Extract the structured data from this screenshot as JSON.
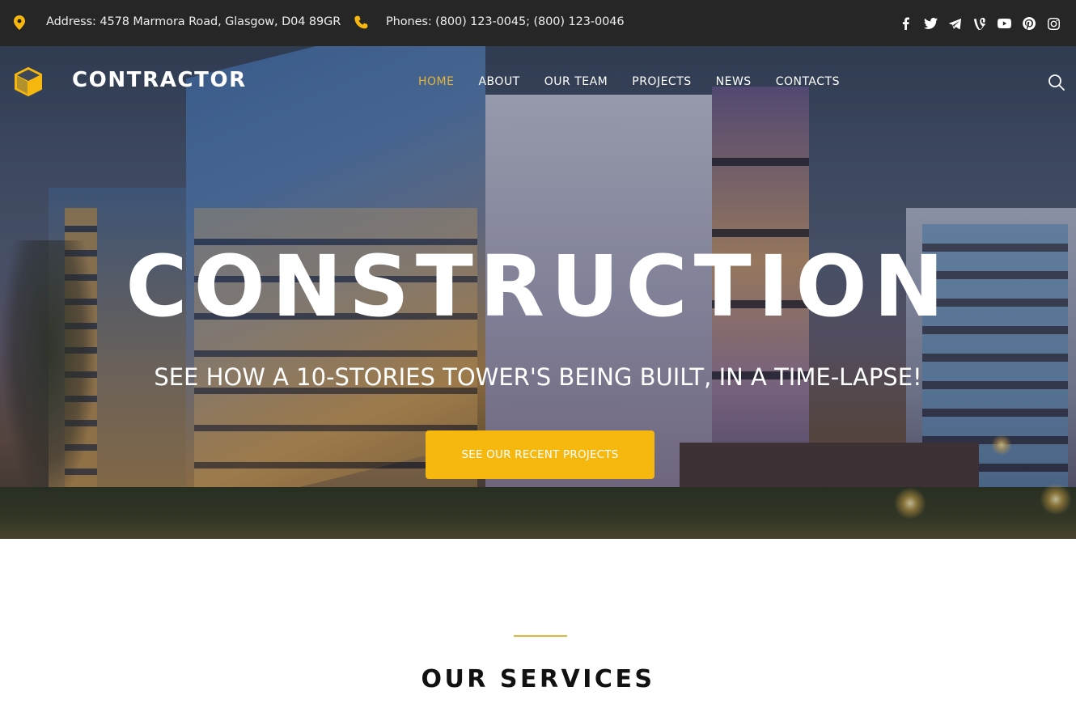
{
  "topbar": {
    "address": "Address: 4578 Marmora Road, Glasgow, D04 89GR",
    "phones": "Phones: (800) 123-0045; (800) 123-0046",
    "socials": [
      {
        "name": "facebook",
        "icon": "facebook-icon"
      },
      {
        "name": "twitter",
        "icon": "twitter-icon"
      },
      {
        "name": "telegram",
        "icon": "telegram-icon"
      },
      {
        "name": "vine",
        "icon": "vine-icon"
      },
      {
        "name": "youtube",
        "icon": "youtube-icon"
      },
      {
        "name": "pinterest",
        "icon": "pinterest-icon"
      },
      {
        "name": "instagram",
        "icon": "instagram-icon"
      }
    ]
  },
  "header": {
    "logo_text": "CONTRACTOR",
    "nav": [
      {
        "label": "HOME",
        "active": true
      },
      {
        "label": "ABOUT",
        "active": false
      },
      {
        "label": "OUR TEAM",
        "active": false
      },
      {
        "label": "PROJECTS",
        "active": false
      },
      {
        "label": "NEWS",
        "active": false
      },
      {
        "label": "CONTACTS",
        "active": false
      }
    ]
  },
  "hero": {
    "title": "CONSTRUCTION",
    "subtitle": "SEE HOW A 10-STORIES TOWER'S BEING BUILT, IN A TIME-LAPSE!",
    "cta_label": "SEE OUR RECENT PROJECTS"
  },
  "services": {
    "title": "OUR SERVICES"
  },
  "colors": {
    "accent": "#f6b80f",
    "topbar_bg": "#262626",
    "nav_active": "#e2b43a"
  }
}
